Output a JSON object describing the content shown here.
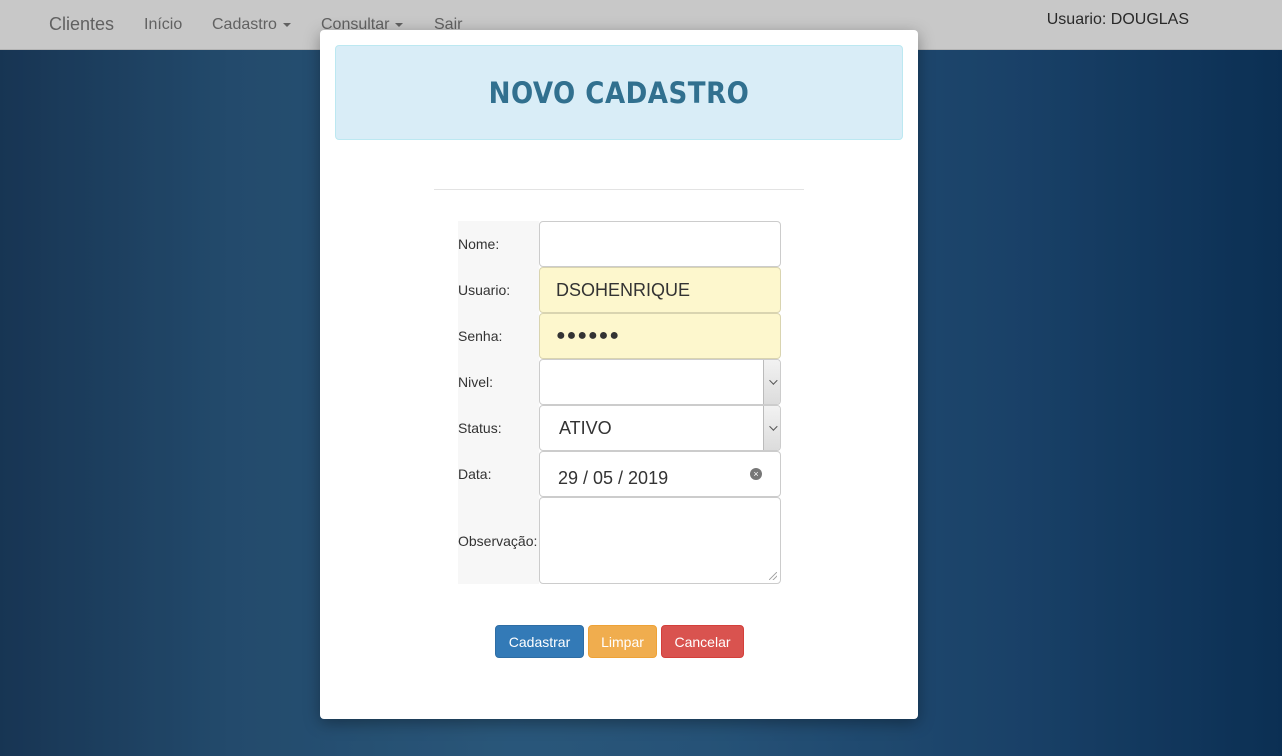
{
  "navbar": {
    "brand": "Clientes",
    "items": [
      {
        "label": "Início",
        "dropdown": false
      },
      {
        "label": "Cadastro",
        "dropdown": true
      },
      {
        "label": "Consultar",
        "dropdown": true
      },
      {
        "label": "Sair",
        "dropdown": false
      }
    ],
    "user": "Usuario: DOUGLAS"
  },
  "modal": {
    "title": "NOVO CADASTRO",
    "fields": {
      "nome": {
        "label": "Nome:",
        "value": ""
      },
      "usuario": {
        "label": "Usuario:",
        "value": "DSOHENRIQUE"
      },
      "senha": {
        "label": "Senha:",
        "value": "●●●●●●"
      },
      "nivel": {
        "label": "Nivel:",
        "value": ""
      },
      "status": {
        "label": "Status:",
        "value": "ATIVO"
      },
      "data": {
        "label": "Data:",
        "value": "29 / 05 / 2019"
      },
      "observacao": {
        "label": "Observação:",
        "value": ""
      }
    },
    "buttons": {
      "cadastrar": "Cadastrar",
      "limpar": "Limpar",
      "cancelar": "Cancelar"
    }
  },
  "icons": {
    "clear": "clear-circle-icon",
    "select": "chevron-down-icon",
    "caret": "caret-down-icon"
  },
  "colors": {
    "primary": "#337ab7",
    "warning": "#f0ad4e",
    "danger": "#d9534f",
    "header_bg": "#d9edf7",
    "title": "#31708f",
    "autofill": "#fdf7cd"
  }
}
